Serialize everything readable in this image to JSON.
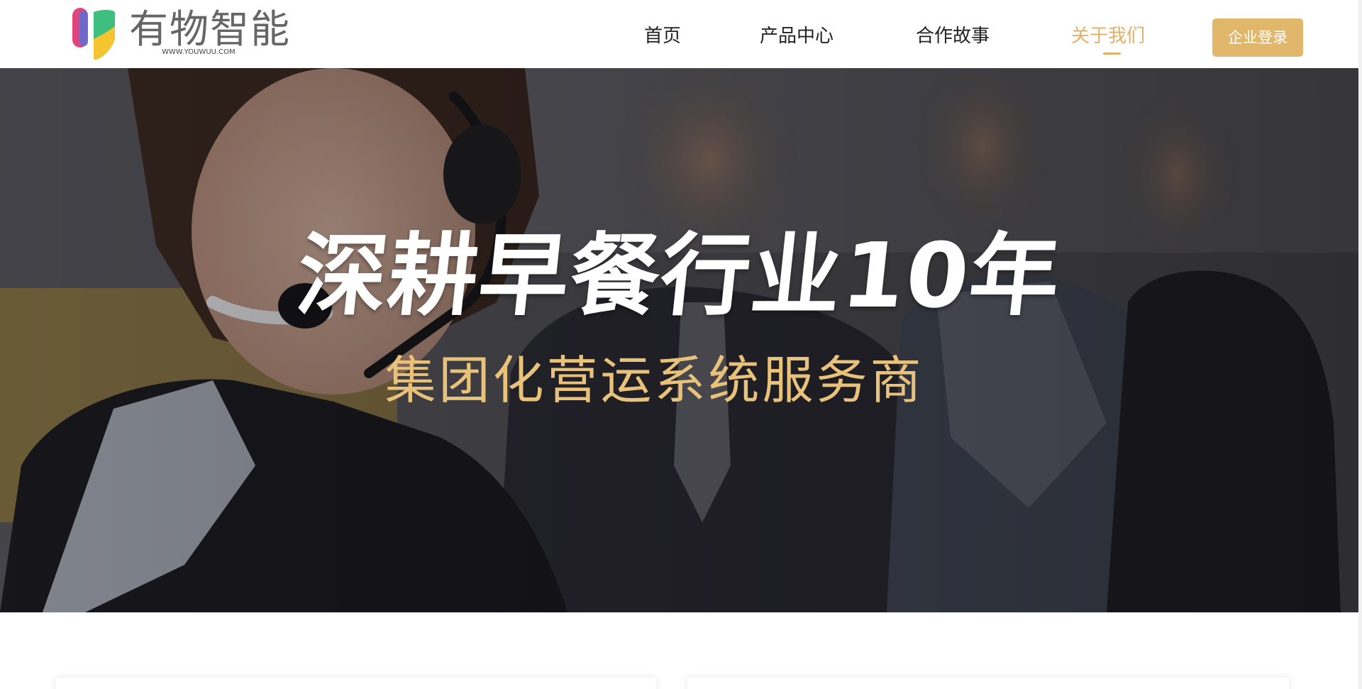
{
  "header": {
    "logo": {
      "name": "有物智能",
      "url": "WWW.YOUWUU.COM",
      "colors": [
        "#e0457b",
        "#5b6fd6",
        "#3fbf7f",
        "#f5c431"
      ]
    },
    "nav": [
      {
        "label": "首页",
        "active": false
      },
      {
        "label": "产品中心",
        "active": false
      },
      {
        "label": "合作故事",
        "active": false
      },
      {
        "label": "关于我们",
        "active": true
      }
    ],
    "login_label": "企业登录"
  },
  "hero": {
    "title": "深耕早餐行业10年",
    "subtitle": "集团化营运系统服务商"
  },
  "colors": {
    "accent": "#e0b166",
    "button": "#e1b86b",
    "nav_text": "#222222",
    "subtitle": "#e8c27a"
  }
}
